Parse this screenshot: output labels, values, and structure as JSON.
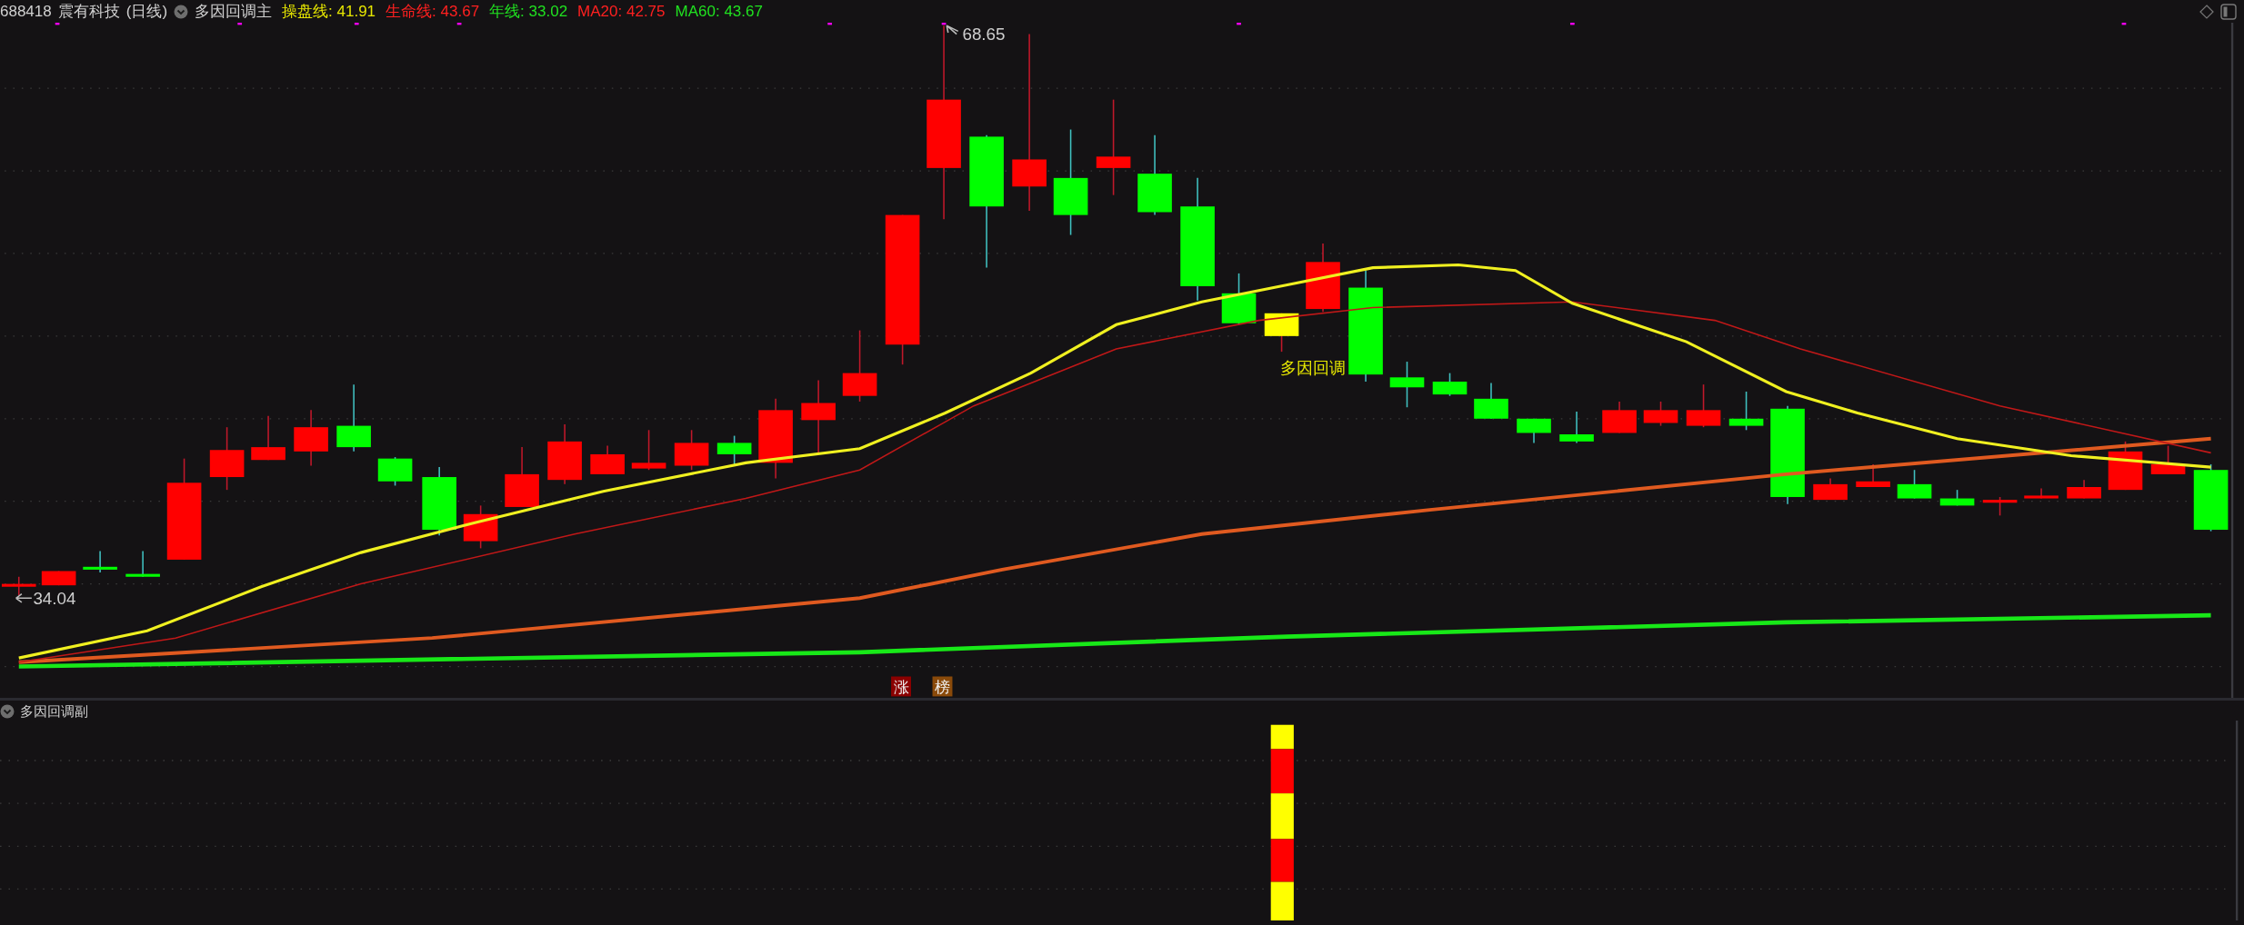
{
  "header": {
    "code": "688418",
    "name": "震有科技",
    "period": "(日线)",
    "indicator": "多因回调主",
    "values": [
      {
        "label": "操盘线:",
        "value": "41.91",
        "color": "#e6e600"
      },
      {
        "label": "生命线:",
        "value": "43.67",
        "color": "#ff2020"
      },
      {
        "label": "年线:",
        "value": "33.02",
        "color": "#20e020"
      },
      {
        "label": "MA20:",
        "value": "42.75",
        "color": "#ff2020"
      },
      {
        "label": "MA60:",
        "value": "43.67",
        "color": "#20e020"
      }
    ]
  },
  "main_chart": {
    "high_label": "68.65",
    "low_label": "34.04",
    "signal_label": "多因回调",
    "badges": [
      {
        "text": "涨",
        "color": "#8b0000"
      },
      {
        "text": "榜",
        "color": "#8a4a0a"
      }
    ]
  },
  "sub_chart": {
    "indicator": "多因回调副"
  }
}
